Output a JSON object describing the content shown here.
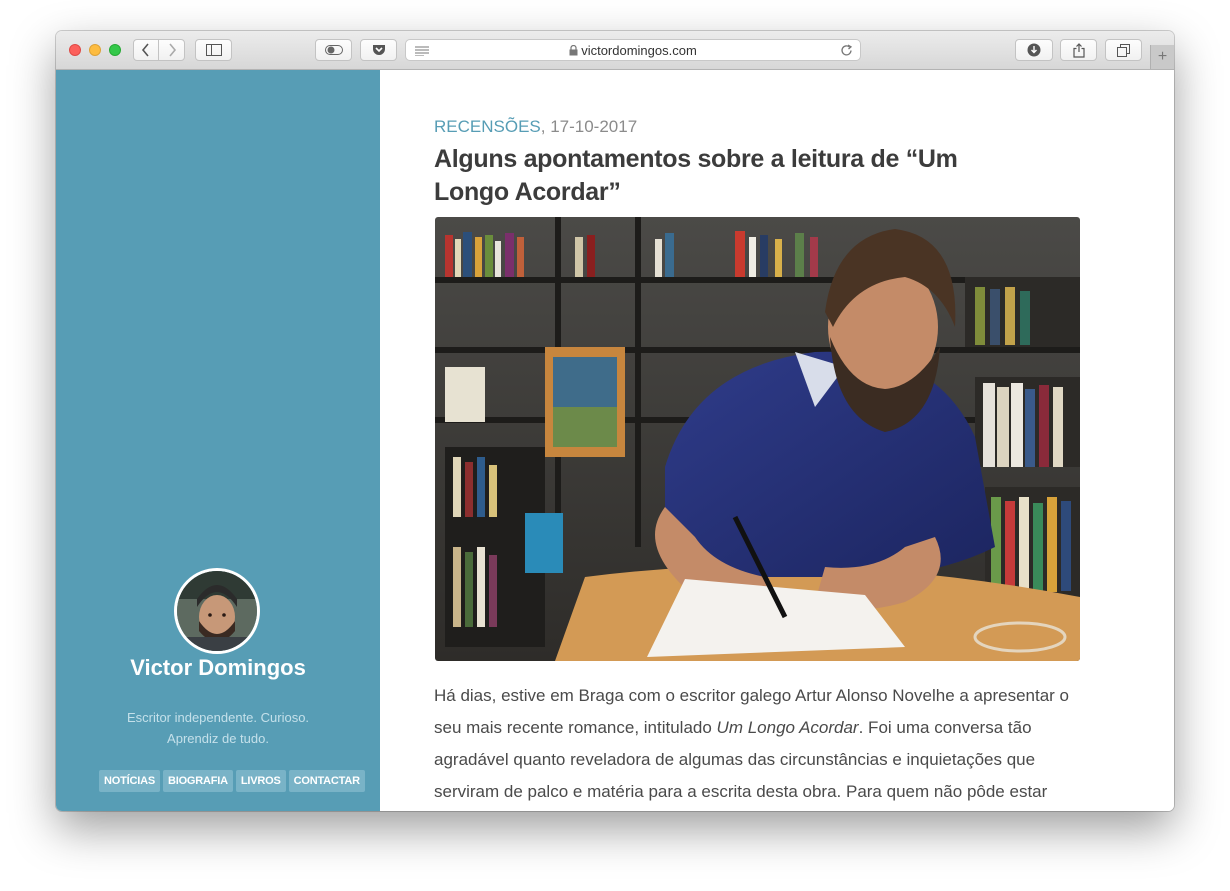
{
  "browser": {
    "url": "victordomingos.com"
  },
  "sidebar": {
    "site_name": "Victor Domingos",
    "tagline_line1": "Escritor independente. Curioso.",
    "tagline_line2": "Aprendiz de tudo.",
    "nav": [
      "NOTÍCIAS",
      "BIOGRAFIA",
      "LIVROS",
      "CONTACTAR"
    ]
  },
  "post": {
    "category": "RECENSÕES",
    "date": ", 17-10-2017",
    "title": "Alguns apontamentos sobre a leitura de “Um Longo Acordar”",
    "body_before": "Há dias, estive em Braga com o escritor galego Artur Alonso Novelhe a apresentar o seu mais recente romance, intitulado ",
    "body_book": "Um Longo Acordar",
    "body_after": ". Foi uma conversa tão agradável quanto reveladora de algumas das circunstâncias e inquietações que serviram de palco e matéria para a escrita desta obra. Para quem não pôde estar"
  },
  "colors": {
    "sidebar_bg": "#579db5",
    "accent": "#579db5",
    "title_text": "#3c3c3c"
  }
}
